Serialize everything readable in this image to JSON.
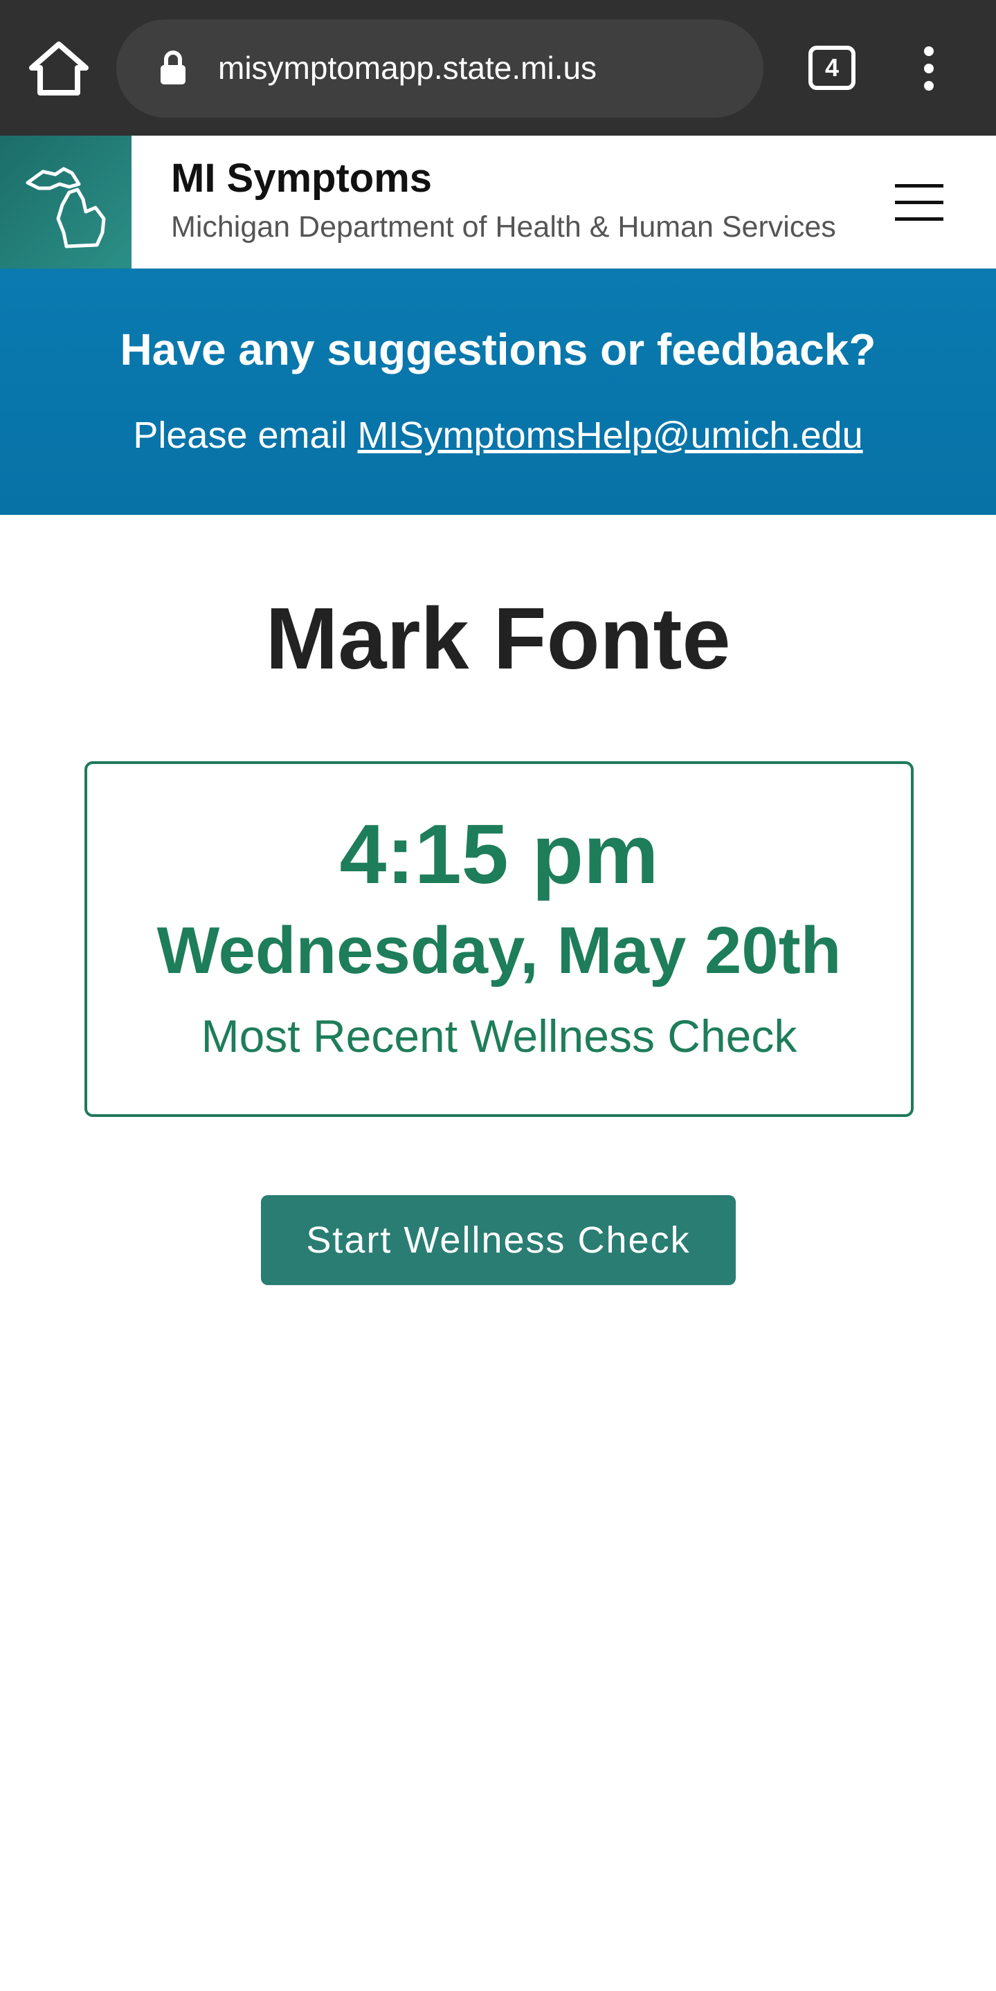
{
  "browser": {
    "url": "misymptomapp.state.mi.us",
    "tab_count": "4"
  },
  "header": {
    "title": "MI Symptoms",
    "subtitle": "Michigan Department of Health & Human Services"
  },
  "banner": {
    "title": "Have any suggestions or feedback?",
    "prefix": "Please email ",
    "email": "MISymptomsHelp@umich.edu"
  },
  "main": {
    "user_name": "Mark Fonte",
    "check_time": "4:15 pm",
    "check_date": "Wednesday, May 20th",
    "check_caption": "Most Recent Wellness Check",
    "start_button": "Start Wellness Check"
  },
  "colors": {
    "browser_chrome": "#303030",
    "banner_blue": "#0a7ab0",
    "accent_green": "#1e7d5a",
    "button_teal": "#2a7d72"
  },
  "icons": {
    "home": "home-icon",
    "lock": "lock-icon",
    "tabs": "tabs-icon",
    "overflow_menu": "vertical-dots-icon",
    "logo": "michigan-map-icon",
    "nav_menu": "hamburger-icon"
  }
}
